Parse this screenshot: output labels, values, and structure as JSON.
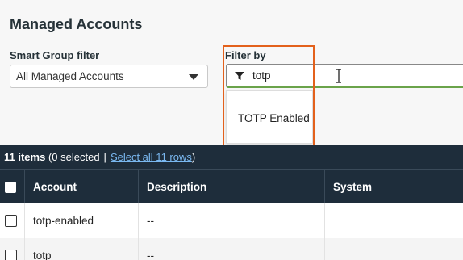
{
  "page": {
    "title": "Managed Accounts"
  },
  "smart_group": {
    "label": "Smart Group filter",
    "value": "All Managed Accounts"
  },
  "filter": {
    "label": "Filter by",
    "value": "totp",
    "suggestion": "TOTP Enabled"
  },
  "summary": {
    "count": "11 items",
    "selected": "(0 selected",
    "separator": "|",
    "select_all": "Select all 11 rows",
    "close": ")"
  },
  "table": {
    "columns": [
      "Account",
      "Description",
      "System"
    ],
    "rows": [
      {
        "account": "totp-enabled",
        "description": "--",
        "system": ""
      },
      {
        "account": "totp",
        "description": "--",
        "system": ""
      }
    ]
  },
  "colors": {
    "header_bg": "#1e2d3b",
    "highlight": "#e3611c",
    "link": "#7ab8f0",
    "focus": "#6aa34a"
  }
}
